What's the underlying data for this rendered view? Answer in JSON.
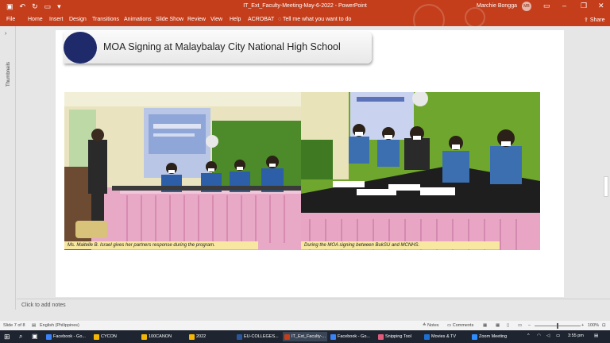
{
  "window": {
    "title": "IT_Ext_Faculty-Meeting-May-6-2022 - PowerPoint",
    "user": "Marchie Bongga",
    "user_initials": "MB"
  },
  "ribbon": {
    "tabs": [
      "File",
      "Home",
      "Insert",
      "Design",
      "Transitions",
      "Animations",
      "Slide Show",
      "Review",
      "View",
      "Help",
      "ACROBAT"
    ],
    "tell_me": "Tell me what you want to do",
    "share": "Share"
  },
  "thumbnails": {
    "label": "Thumbnails"
  },
  "slide": {
    "title": "MOA Signing at Malaybalay City National High School",
    "captions": [
      "Ms. Maitelle B. Israel gives her partners response during the program.",
      "During the MOA signing between BukSU and MCNHS."
    ]
  },
  "notes": {
    "placeholder": "Click to add notes"
  },
  "status": {
    "slide": "Slide 7 of 8",
    "language": "English (Philippines)",
    "notes": "Notes",
    "comments": "Comments",
    "zoom": "100%"
  },
  "taskbar": {
    "items": [
      {
        "label": "Facebook - Go...",
        "color": "#3b82f6"
      },
      {
        "label": "CYCON",
        "color": "#f2b705"
      },
      {
        "label": "100CANON",
        "color": "#f2b705"
      },
      {
        "label": "2022",
        "color": "#f2b705"
      },
      {
        "label": "EU-COLLEGES...",
        "color": "#2b579a"
      },
      {
        "label": "IT_Ext_Faculty-...",
        "color": "#c43e1c"
      },
      {
        "label": "Facebook - Go...",
        "color": "#3b82f6"
      },
      {
        "label": "Snipping Tool",
        "color": "#e05a7a"
      },
      {
        "label": "Movies & TV",
        "color": "#1f6fd1"
      },
      {
        "label": "Zoom Meeting",
        "color": "#2d8cff"
      }
    ],
    "time": "3:55 pm"
  },
  "colors": {
    "accent": "#c43e1c",
    "title_circle": "#1f2a6b",
    "caption_bg": "#f7e7a0"
  }
}
